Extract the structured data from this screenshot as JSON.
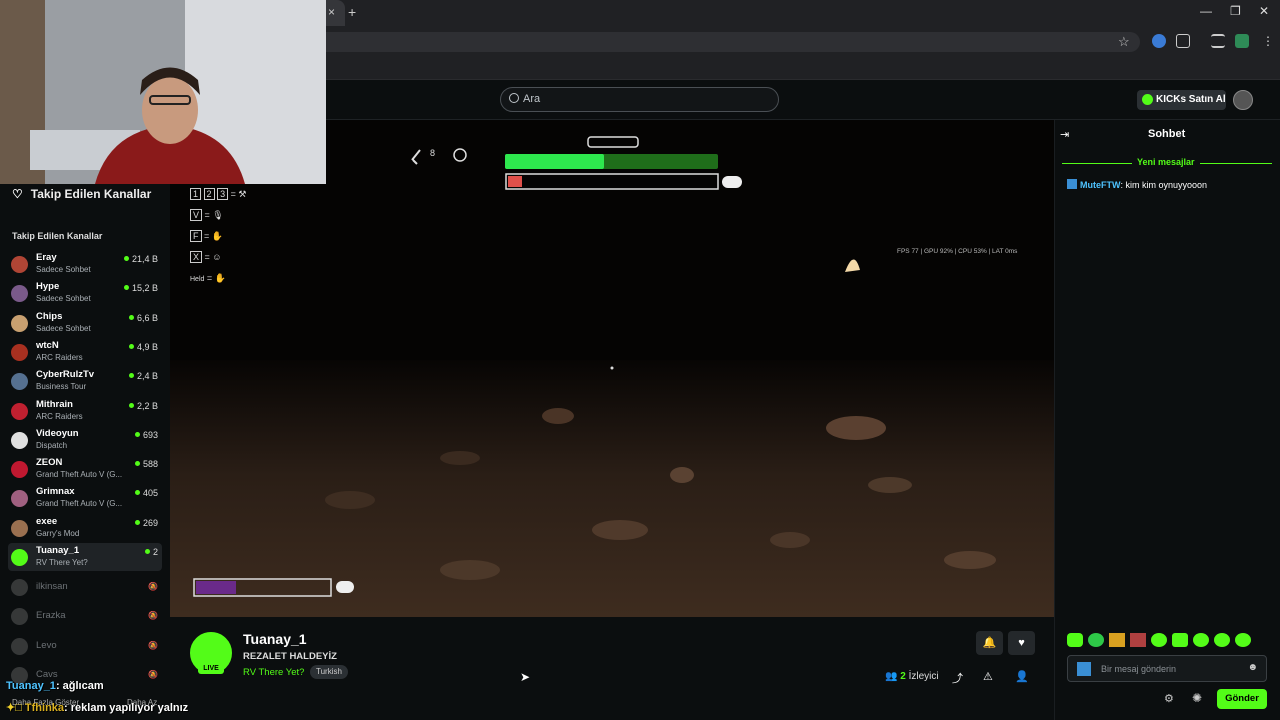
{
  "browser": {
    "tab_close": "×",
    "new_tab": "+"
  },
  "nav": {
    "search_placeholder": "Ara",
    "kicks_button": "KICKs Satın Al"
  },
  "sidebar": {
    "followed_header": "Takip Edilen Kanallar",
    "section_title": "Takip Edilen Kanallar",
    "channels": [
      {
        "name": "Eray",
        "game": "Sadece Sohbet",
        "viewers": "21,4 B",
        "color": "#b04535"
      },
      {
        "name": "Hype",
        "game": "Sadece Sohbet",
        "viewers": "15,2 B",
        "color": "#7a5a8a"
      },
      {
        "name": "Chips",
        "game": "Sadece Sohbet",
        "viewers": "6,6 B",
        "color": "#c8a070"
      },
      {
        "name": "wtcN",
        "game": "ARC Raiders",
        "viewers": "4,9 B",
        "color": "#a83020"
      },
      {
        "name": "CyberRulzTv",
        "game": "Business Tour",
        "viewers": "2,4 B",
        "color": "#557090"
      },
      {
        "name": "Mithrain",
        "game": "ARC Raiders",
        "viewers": "2,2 B",
        "color": "#c02030"
      },
      {
        "name": "Videoyun",
        "game": "Dispatch",
        "viewers": "693",
        "color": "#e0e0e0"
      },
      {
        "name": "ZEON",
        "game": "Grand Theft Auto V (G...",
        "viewers": "588",
        "color": "#c01830"
      },
      {
        "name": "Grimnax",
        "game": "Grand Theft Auto V (G...",
        "viewers": "405",
        "color": "#a06080"
      },
      {
        "name": "exee",
        "game": "Garry's Mod",
        "viewers": "269",
        "color": "#9a7050"
      },
      {
        "name": "Tuanay_1",
        "game": "RV There Yet?",
        "viewers": "2",
        "color": "#53fc18"
      }
    ],
    "offline": [
      {
        "name": "ilkinsan"
      },
      {
        "name": "Erazka"
      },
      {
        "name": "Levo"
      },
      {
        "name": "Cavs"
      }
    ],
    "show_more": "Daha Fazla Göster",
    "show_less": "Daha Az"
  },
  "game_hud": {
    "stats": "FPS 77  |  GPU 92%  |  CPU 53%  |  LAT 0ms",
    "item_count": "8",
    "keys": [
      "1",
      "2",
      "3",
      "V",
      "F",
      "X"
    ],
    "held_label": "Held"
  },
  "stream": {
    "streamer": "Tuanay_1",
    "title": "REZALET HALDEYİZ",
    "category": "RV There Yet?",
    "tag": "Turkish",
    "live_badge": "LIVE",
    "viewers_count": "2",
    "viewers_label": "İzleyici"
  },
  "chat": {
    "title": "Sohbet",
    "new_messages": "Yeni mesajlar",
    "messages": [
      {
        "user": "MuteFTW",
        "text": "kim kim oynuyyooon"
      }
    ],
    "input_placeholder": "Bir mesaj gönderin",
    "send_label": "Gönder"
  },
  "overlay_chat": [
    {
      "user": "Tuanay_1",
      "text": ": ağlıcam"
    },
    {
      "user": "Tfhinka",
      "text": ": reklam yapılıyor yalnız"
    }
  ],
  "colors": {
    "brand": "#53fc18",
    "background": "#0b0e0f",
    "panel": "#24282b"
  }
}
